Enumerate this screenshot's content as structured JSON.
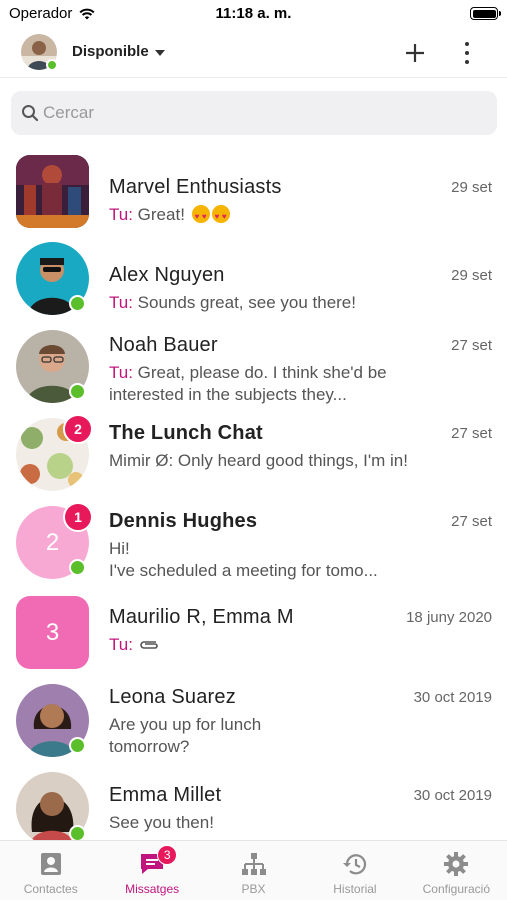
{
  "status_bar": {
    "carrier": "Operador",
    "time": "11:18 a. m."
  },
  "header": {
    "presence": "Disponible"
  },
  "search": {
    "placeholder": "Cercar"
  },
  "you_prefix": "Tu:",
  "chats": [
    {
      "name": "Marvel Enthusiasts",
      "date": "29 set",
      "from_you": true,
      "preview": "Great!",
      "emoji": "heart-eyes-emoji x2",
      "avatar": "group-photo",
      "online": false,
      "unread": "",
      "bold": false
    },
    {
      "name": "Alex Nguyen",
      "date": "29 set",
      "from_you": true,
      "preview": "Sounds great, see you there!",
      "avatar": "photo",
      "online": true,
      "unread": "",
      "bold": false
    },
    {
      "name": "Noah Bauer",
      "date": "27 set",
      "from_you": true,
      "preview": "Great, please do. I think she'd be interested in the subjects they...",
      "avatar": "photo",
      "online": true,
      "unread": "",
      "bold": false
    },
    {
      "name": "The Lunch Chat",
      "date": "27 set",
      "from_you": false,
      "preview": "Mimir Ø: Only heard good things, I'm in!",
      "avatar": "food-photo",
      "online": false,
      "unread": "2",
      "bold": true
    },
    {
      "name": "Dennis Hughes",
      "date": "27 set",
      "from_you": false,
      "preview": "Hi!\nI've scheduled a meeting for tomo...",
      "avatar_text": "2",
      "online": true,
      "unread": "1",
      "bold": true
    },
    {
      "name": "Maurilio R, Emma M",
      "date": "18 juny 2020",
      "from_you": true,
      "preview": "",
      "attachment_icon": "paperclip-icon",
      "avatar_text": "3",
      "online": false,
      "unread": "",
      "bold": false
    },
    {
      "name": "Leona Suarez",
      "date": "30 oct 2019",
      "from_you": false,
      "preview": "Are you up for lunch tomorrow?",
      "avatar": "photo",
      "online": true,
      "unread": "",
      "bold": false
    },
    {
      "name": "Emma Millet",
      "date": "30 oct 2019",
      "from_you": false,
      "preview": "See you then!",
      "avatar": "photo",
      "online": true,
      "unread": "",
      "bold": false
    }
  ],
  "tabs": [
    {
      "label": "Contactes",
      "icon": "contacts-icon",
      "active": false
    },
    {
      "label": "Missatges",
      "icon": "messages-icon",
      "active": true,
      "badge": "3"
    },
    {
      "label": "PBX",
      "icon": "pbx-icon",
      "active": false
    },
    {
      "label": "Historial",
      "icon": "history-icon",
      "active": false
    },
    {
      "label": "Configuració",
      "icon": "gear-icon",
      "active": false
    }
  ],
  "colors": {
    "accent": "#c0157e",
    "badge": "#e8195a",
    "online": "#5bbf2b",
    "pink_light": "#f7a9d4",
    "pink": "#f06bb4"
  }
}
